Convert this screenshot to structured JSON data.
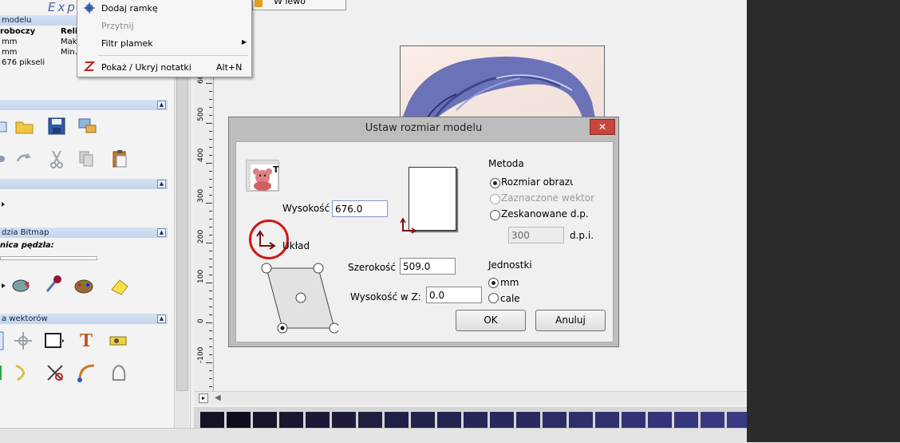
{
  "menu": {
    "top_item": "W lewo",
    "items": [
      {
        "label": "Dodaj ramkę",
        "shortcut": "",
        "disabled": false
      },
      {
        "label": "Przytnij",
        "shortcut": "",
        "disabled": true
      },
      {
        "label": "Filtr plamek",
        "shortcut": "",
        "disabled": false,
        "submenu": true
      },
      {
        "label": "Pokaż / Ukryj notatki",
        "shortcut": "Alt+N",
        "disabled": false
      }
    ]
  },
  "left_panel": {
    "model_header": "modelu",
    "header_logo": "Exp",
    "col1_title": "roboczy",
    "col2_title": "Reli",
    "rows": [
      {
        "c1": "mm",
        "c2": "Mak"
      },
      {
        "c1": "mm",
        "c2": "Min."
      },
      {
        "c1": "676 pikseli",
        "c2": ""
      }
    ],
    "section_bitmap": "dzia Bitmap",
    "brush_label": "nica pędzla:",
    "section_vectors": "a wektorów"
  },
  "ruler": {
    "labels": [
      "600",
      "500",
      "400",
      "300",
      "200",
      "100",
      "0",
      "-100"
    ]
  },
  "dialog": {
    "title": "Ustaw rozmiar modelu",
    "close": "✕",
    "height_label": "Wysokość",
    "height_value": "676.0",
    "layout_label": "Układ",
    "width_label": "Szerokość",
    "width_value": "509.0",
    "z_label": "Wysokość w Z:",
    "z_value": "0.0",
    "method_label": "Metoda",
    "method_options": [
      "Rozmiar obrazu",
      "Zaznaczone wektor",
      "Zeskanowane d.p."
    ],
    "dpi_value": "300",
    "dpi_unit": "d.p.i.",
    "units_label": "Jednostki",
    "unit_options": [
      "mm",
      "cale"
    ],
    "ok": "OK",
    "cancel": "Anuluj"
  },
  "colors": {
    "accent_red": "#d01818",
    "dialog_close": "#c9463d"
  }
}
